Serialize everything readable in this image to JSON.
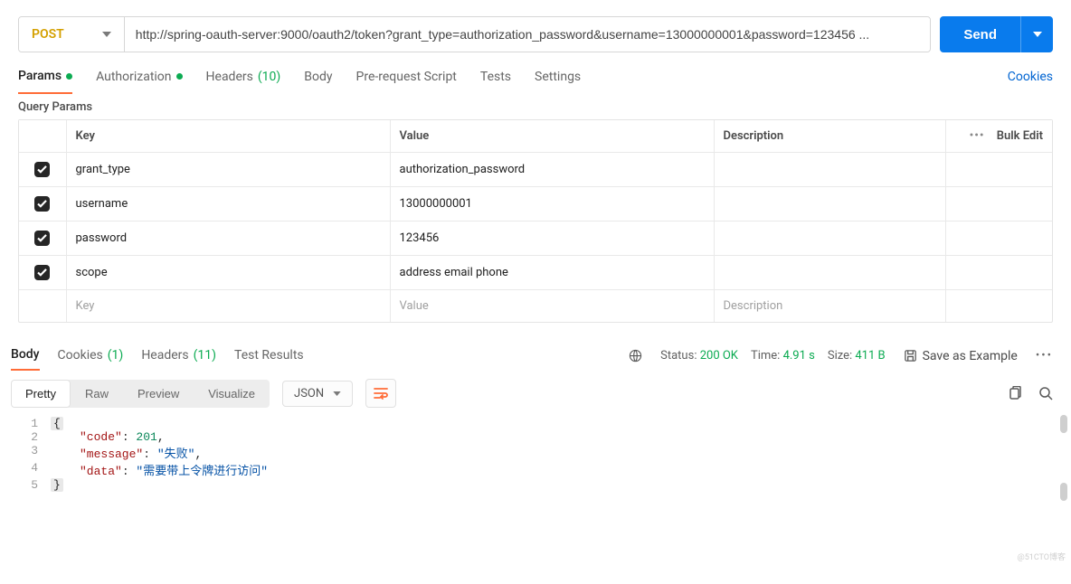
{
  "request": {
    "method": "POST",
    "url": "http://spring-oauth-server:9000/oauth2/token?grant_type=authorization_password&username=13000000001&password=123456 ...",
    "send_label": "Send"
  },
  "req_tabs": {
    "params": "Params",
    "authorization": "Authorization",
    "headers": "Headers",
    "headers_count": "(10)",
    "body": "Body",
    "prerequest": "Pre-request Script",
    "tests": "Tests",
    "settings": "Settings",
    "cookies": "Cookies"
  },
  "qp_label": "Query Params",
  "table": {
    "headers": {
      "key": "Key",
      "value": "Value",
      "description": "Description",
      "bulk": "Bulk Edit"
    },
    "rows": [
      {
        "key": "grant_type",
        "value": "authorization_password"
      },
      {
        "key": "username",
        "value": "13000000001"
      },
      {
        "key": "password",
        "value": "123456"
      },
      {
        "key": "scope",
        "value": "address email phone"
      }
    ],
    "placeholders": {
      "key": "Key",
      "value": "Value",
      "description": "Description"
    }
  },
  "resp_tabs": {
    "body": "Body",
    "cookies": "Cookies",
    "cookies_count": "(1)",
    "headers": "Headers",
    "headers_count": "(11)",
    "tests": "Test Results"
  },
  "status": {
    "label": "Status:",
    "code": "200 OK",
    "time_label": "Time:",
    "time": "4.91 s",
    "size_label": "Size:",
    "size": "411 B",
    "save": "Save as Example"
  },
  "view_modes": {
    "pretty": "Pretty",
    "raw": "Raw",
    "preview": "Preview",
    "visualize": "Visualize",
    "lang": "JSON"
  },
  "response_json": {
    "lines": [
      {
        "n": "1",
        "html": "<span class='brace-box'>{</span>"
      },
      {
        "n": "2",
        "html": "<span class='ind'></span><span class='k'>\"code\"</span><span class='colon'>: </span><span class='num'>201</span>,"
      },
      {
        "n": "3",
        "html": "<span class='ind'></span><span class='k'>\"message\"</span><span class='colon'>: </span><span class='str'>\"失败\"</span>,"
      },
      {
        "n": "4",
        "html": "<span class='ind'></span><span class='k'>\"data\"</span><span class='colon'>: </span><span class='str'>\"需要带上令牌进行访问\"</span>"
      },
      {
        "n": "5",
        "html": "<span class='brace-box'>}</span>"
      }
    ]
  },
  "watermark": "@51CTO博客"
}
